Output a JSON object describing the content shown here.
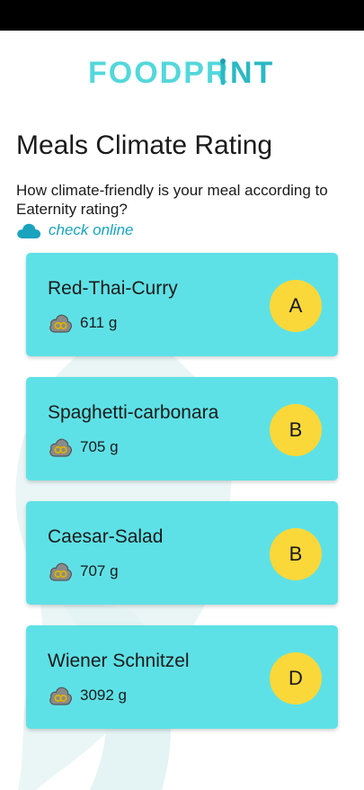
{
  "app": {
    "logo_text_part1": "FOODPR",
    "logo_text_part2": "NT"
  },
  "page": {
    "title": "Meals Climate Rating",
    "subtitle": "How climate-friendly is your meal according to Eaternity rating?",
    "check_online_label": "check online"
  },
  "colors": {
    "brand_teal": "#5ee1e6",
    "badge_yellow": "#fbd83a",
    "link_blue": "#1aa3bf"
  },
  "meals": [
    {
      "name": "Red-Thai-Curry",
      "co2": "611 g",
      "grade": "A"
    },
    {
      "name": "Spaghetti-carbonara",
      "co2": "705 g",
      "grade": "B"
    },
    {
      "name": "Caesar-Salad",
      "co2": "707 g",
      "grade": "B"
    },
    {
      "name": "Wiener Schnitzel",
      "co2": "3092 g",
      "grade": "D"
    }
  ],
  "icons": {
    "cloud": "cloud-icon",
    "co2": "co2-cloud-icon"
  }
}
